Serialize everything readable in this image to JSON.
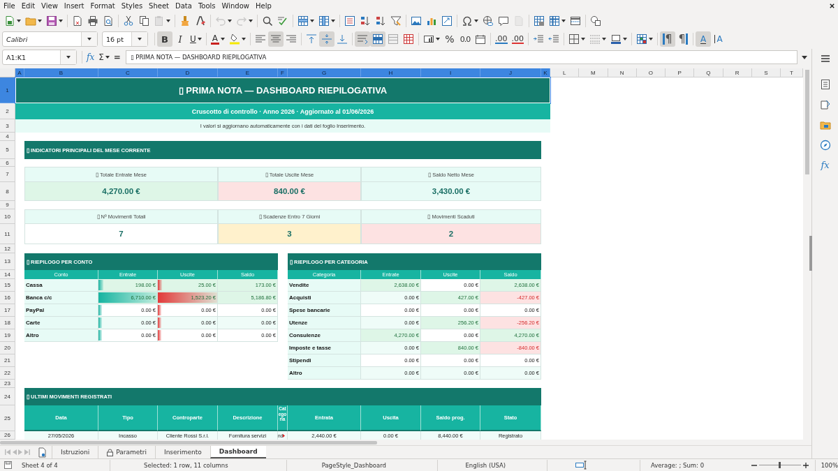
{
  "menu": [
    "File",
    "Edit",
    "View",
    "Insert",
    "Format",
    "Styles",
    "Sheet",
    "Data",
    "Tools",
    "Window",
    "Help"
  ],
  "standard_toolbar": [
    {
      "kind": "new-document",
      "dropdown": true,
      "disabled": false
    },
    {
      "kind": "open-file",
      "dropdown": true,
      "disabled": false
    },
    {
      "kind": "save",
      "dropdown": true,
      "disabled": false
    },
    {
      "kind": "separator"
    },
    {
      "kind": "export-pdf",
      "dropdown": false,
      "disabled": false
    },
    {
      "kind": "print",
      "dropdown": false,
      "disabled": false
    },
    {
      "kind": "print-preview",
      "dropdown": false,
      "disabled": false
    },
    {
      "kind": "separator"
    },
    {
      "kind": "cut",
      "dropdown": false,
      "disabled": false
    },
    {
      "kind": "copy",
      "dropdown": false,
      "disabled": false
    },
    {
      "kind": "paste",
      "dropdown": true,
      "disabled": true
    },
    {
      "kind": "separator"
    },
    {
      "kind": "clone-formatting",
      "dropdown": false,
      "disabled": false
    },
    {
      "kind": "clear-formatting",
      "dropdown": false,
      "disabled": false
    },
    {
      "kind": "separator"
    },
    {
      "kind": "undo",
      "dropdown": true,
      "disabled": true
    },
    {
      "kind": "redo",
      "dropdown": true,
      "disabled": true
    },
    {
      "kind": "separator"
    },
    {
      "kind": "find-replace",
      "dropdown": false,
      "disabled": false
    },
    {
      "kind": "spelling",
      "dropdown": false,
      "disabled": false
    },
    {
      "kind": "separator"
    },
    {
      "kind": "insert-rows",
      "dropdown": true,
      "disabled": false
    },
    {
      "kind": "insert-columns",
      "dropdown": true,
      "disabled": false
    },
    {
      "kind": "separator"
    },
    {
      "kind": "sort",
      "dropdown": false,
      "disabled": false
    },
    {
      "kind": "sort-ascending",
      "dropdown": false,
      "disabled": false
    },
    {
      "kind": "sort-descending",
      "dropdown": false,
      "disabled": false
    },
    {
      "kind": "autofilter",
      "dropdown": false,
      "disabled": false
    },
    {
      "kind": "separator"
    },
    {
      "kind": "insert-image",
      "dropdown": false,
      "disabled": false
    },
    {
      "kind": "insert-chart",
      "dropdown": false,
      "disabled": false
    },
    {
      "kind": "pivot-table",
      "dropdown": false,
      "disabled": false
    },
    {
      "kind": "separator"
    },
    {
      "kind": "special-character",
      "dropdown": true,
      "disabled": false
    },
    {
      "kind": "hyperlink",
      "dropdown": false,
      "disabled": false
    },
    {
      "kind": "comment",
      "dropdown": false,
      "disabled": false
    },
    {
      "kind": "header-footer",
      "dropdown": false,
      "disabled": true
    },
    {
      "kind": "separator"
    },
    {
      "kind": "print-range",
      "dropdown": false,
      "disabled": false
    },
    {
      "kind": "freeze-panes",
      "dropdown": true,
      "disabled": false
    },
    {
      "kind": "split-window",
      "dropdown": false,
      "disabled": false
    },
    {
      "kind": "separator"
    },
    {
      "kind": "shapes",
      "dropdown": false,
      "disabled": false
    }
  ],
  "font_name": "Calibri",
  "font_size": "16 pt",
  "format_toolbar": [
    {
      "kind": "bold",
      "label": "B",
      "dropdown": false,
      "pressed": true
    },
    {
      "kind": "italic",
      "label": "I",
      "dropdown": false,
      "pressed": false
    },
    {
      "kind": "underline",
      "label": "U",
      "dropdown": true,
      "pressed": false
    },
    {
      "kind": "separator"
    },
    {
      "kind": "font-color",
      "label": "A",
      "dropdown": true,
      "pressed": false
    },
    {
      "kind": "highlight",
      "dropdown": true,
      "pressed": false
    },
    {
      "kind": "separator"
    },
    {
      "kind": "align-left",
      "dropdown": false,
      "pressed": false
    },
    {
      "kind": "align-center",
      "dropdown": false,
      "pressed": true
    },
    {
      "kind": "align-right",
      "dropdown": false,
      "pressed": false
    },
    {
      "kind": "separator"
    },
    {
      "kind": "align-top",
      "dropdown": false,
      "pressed": false
    },
    {
      "kind": "align-middle",
      "dropdown": false,
      "pressed": true
    },
    {
      "kind": "align-bottom",
      "dropdown": false,
      "pressed": false
    },
    {
      "kind": "separator"
    },
    {
      "kind": "wrap-text",
      "dropdown": false,
      "pressed": true
    },
    {
      "kind": "merge-center",
      "dropdown": false,
      "pressed": true
    },
    {
      "kind": "merge-cells",
      "dropdown": false,
      "pressed": false
    },
    {
      "kind": "unmerge-cells",
      "dropdown": false,
      "pressed": false
    },
    {
      "kind": "separator"
    },
    {
      "kind": "number-format",
      "dropdown": true,
      "pressed": false
    },
    {
      "kind": "percent",
      "label": "%",
      "dropdown": false,
      "pressed": false
    },
    {
      "kind": "number",
      "label": "0.0",
      "dropdown": false,
      "pressed": false
    },
    {
      "kind": "date",
      "dropdown": false,
      "pressed": false
    },
    {
      "kind": "separator"
    },
    {
      "kind": "add-decimal",
      "label": ".00",
      "dropdown": false,
      "pressed": false
    },
    {
      "kind": "delete-decimal",
      "label": ".00",
      "dropdown": false,
      "pressed": false
    },
    {
      "kind": "separator"
    },
    {
      "kind": "increase-indent",
      "dropdown": false,
      "pressed": false
    },
    {
      "kind": "decrease-indent",
      "dropdown": false,
      "pressed": false
    },
    {
      "kind": "separator"
    },
    {
      "kind": "borders",
      "dropdown": true,
      "pressed": false
    },
    {
      "kind": "border-style",
      "dropdown": true,
      "pressed": false
    },
    {
      "kind": "border-color",
      "dropdown": true,
      "pressed": false
    },
    {
      "kind": "separator"
    },
    {
      "kind": "conditional-format",
      "dropdown": true,
      "pressed": false
    },
    {
      "kind": "separator"
    },
    {
      "kind": "left-to-right",
      "label": "¶",
      "dropdown": false,
      "pressed": true
    },
    {
      "kind": "right-to-left",
      "label": "¶",
      "dropdown": false,
      "pressed": false
    },
    {
      "kind": "separator"
    },
    {
      "kind": "text-left-to-right",
      "label": "A",
      "dropdown": false,
      "pressed": true
    },
    {
      "kind": "text-top-to-bottom",
      "label": "A",
      "dropdown": false,
      "pressed": false
    }
  ],
  "formula_bar": {
    "name_box": "A1:K1",
    "function_label": "fx",
    "sum_label": "Σ",
    "equals_label": "=",
    "content": "▯ PRIMA NOTA — DASHBOARD RIEPILOGATIVA"
  },
  "sidebar": {
    "functions_label": "fx"
  },
  "columns": [
    {
      "label": "A",
      "selected": true
    },
    {
      "label": "B",
      "selected": true
    },
    {
      "label": "C",
      "selected": true
    },
    {
      "label": "D",
      "selected": true
    },
    {
      "label": "E",
      "selected": true
    },
    {
      "label": "F",
      "selected": true
    },
    {
      "label": "G",
      "selected": true
    },
    {
      "label": "H",
      "selected": true
    },
    {
      "label": "I",
      "selected": true
    },
    {
      "label": "J",
      "selected": true
    },
    {
      "label": "K",
      "selected": true
    },
    {
      "label": "L",
      "selected": false
    },
    {
      "label": "M",
      "selected": false
    },
    {
      "label": "N",
      "selected": false
    },
    {
      "label": "O",
      "selected": false
    },
    {
      "label": "P",
      "selected": false
    },
    {
      "label": "Q",
      "selected": false
    },
    {
      "label": "R",
      "selected": false
    },
    {
      "label": "S",
      "selected": false
    },
    {
      "label": "T",
      "selected": false
    }
  ],
  "rows": [
    {
      "label": "1",
      "selected": true
    },
    {
      "label": "2",
      "selected": false
    },
    {
      "label": "3",
      "selected": false
    },
    {
      "label": "4",
      "selected": false
    },
    {
      "label": "5",
      "selected": false
    },
    {
      "label": "6",
      "selected": false
    },
    {
      "label": "7",
      "selected": false
    },
    {
      "label": "8",
      "selected": false
    },
    {
      "label": "9",
      "selected": false
    },
    {
      "label": "10",
      "selected": false
    },
    {
      "label": "11",
      "selected": false
    },
    {
      "label": "12",
      "selected": false
    },
    {
      "label": "13",
      "selected": false
    },
    {
      "label": "14",
      "selected": false
    },
    {
      "label": "15",
      "selected": false
    },
    {
      "label": "16",
      "selected": false
    },
    {
      "label": "17",
      "selected": false
    },
    {
      "label": "18",
      "selected": false
    },
    {
      "label": "19",
      "selected": false
    },
    {
      "label": "20",
      "selected": false
    },
    {
      "label": "21",
      "selected": false
    },
    {
      "label": "22",
      "selected": false
    },
    {
      "label": "23",
      "selected": false
    },
    {
      "label": "24",
      "selected": false
    },
    {
      "label": "25",
      "selected": false
    },
    {
      "label": "26",
      "selected": false
    }
  ],
  "title": "▯ PRIMA NOTA — DASHBOARD RIEPILOGATIVA",
  "subtitle": "Cruscotto di controllo · Anno 2026 · Aggiornato al 01/06/2026",
  "note": "I valori si aggiornano automaticamente con i dati del foglio Inserimento.",
  "kpi_section": "▯ INDICATORI PRINCIPALI DEL MESE CORRENTE",
  "kpis": [
    {
      "label": "▯ Totale Entrate Mese",
      "value": "4,270.00 €",
      "color": "#def6e7"
    },
    {
      "label": "▯ Totale Uscite Mese",
      "value": "840.00 €",
      "color": "#fde2e2"
    },
    {
      "label": "▯ Saldo Netto Mese",
      "value": "3,430.00 €",
      "color": "#e7fbf6"
    },
    {
      "label": "▯ Nº Movimenti Totali",
      "value": "7",
      "color": "#ffffff"
    },
    {
      "label": "▯ Scadenze Entro 7 Giorni",
      "value": "3",
      "color": "#fff1cc"
    },
    {
      "label": "▯ Movimenti Scaduti",
      "value": "2",
      "color": "#fde2e2"
    }
  ],
  "account_summary": {
    "title": "▯ RIEPILOGO PER CONTO",
    "columns": [
      "Conto",
      "Entrate",
      "Uscite",
      "Saldo"
    ],
    "rows": [
      {
        "name": "Cassa",
        "in": {
          "text": "198.00 €",
          "kind": "positive",
          "level": 0.03
        },
        "out": {
          "text": "25.00 €",
          "kind": "positive",
          "level": 0.016
        },
        "balance": {
          "text": "173.00 €",
          "kind": "positive"
        }
      },
      {
        "name": "Banca c/c",
        "in": {
          "text": "6,710.00 €",
          "kind": "positive",
          "level": 1
        },
        "out": {
          "text": "1,523.20 €",
          "kind": "positive",
          "level": 1
        },
        "balance": {
          "text": "5,186.80 €",
          "kind": "positive"
        }
      },
      {
        "name": "PayPal",
        "in": {
          "text": "0.00 €",
          "kind": "zero",
          "level": 0
        },
        "out": {
          "text": "0.00 €",
          "kind": "zero",
          "level": 0
        },
        "balance": {
          "text": "0.00 €",
          "kind": "zero"
        }
      },
      {
        "name": "Carte",
        "in": {
          "text": "0.00 €",
          "kind": "zero",
          "level": 0
        },
        "out": {
          "text": "0.00 €",
          "kind": "zero",
          "level": 0
        },
        "balance": {
          "text": "0.00 €",
          "kind": "zero"
        }
      },
      {
        "name": "Altro",
        "in": {
          "text": "0.00 €",
          "kind": "zero",
          "level": 0
        },
        "out": {
          "text": "0.00 €",
          "kind": "zero",
          "level": 0
        },
        "balance": {
          "text": "0.00 €",
          "kind": "zero"
        }
      }
    ]
  },
  "category_summary": {
    "title": "▯ RIEPILOGO PER CATEGORIA",
    "columns": [
      "Categoria",
      "Entrate",
      "Uscite",
      "Saldo"
    ],
    "rows": [
      {
        "name": "Vendite",
        "in": {
          "text": "2,638.00 €",
          "kind": "positive"
        },
        "out": {
          "text": "0.00 €",
          "kind": "zero"
        },
        "balance": {
          "text": "2,638.00 €",
          "kind": "positive"
        }
      },
      {
        "name": "Acquisti",
        "in": {
          "text": "0.00 €",
          "kind": "zero"
        },
        "out": {
          "text": "427.00 €",
          "kind": "positive"
        },
        "balance": {
          "text": "-427.00 €",
          "kind": "negative"
        }
      },
      {
        "name": "Spese bancarie",
        "in": {
          "text": "0.00 €",
          "kind": "zero"
        },
        "out": {
          "text": "0.00 €",
          "kind": "zero"
        },
        "balance": {
          "text": "0.00 €",
          "kind": "zero"
        }
      },
      {
        "name": "Utenze",
        "in": {
          "text": "0.00 €",
          "kind": "zero"
        },
        "out": {
          "text": "256.20 €",
          "kind": "positive"
        },
        "balance": {
          "text": "-256.20 €",
          "kind": "negative"
        }
      },
      {
        "name": "Consulenze",
        "in": {
          "text": "4,270.00 €",
          "kind": "positive"
        },
        "out": {
          "text": "0.00 €",
          "kind": "zero"
        },
        "balance": {
          "text": "4,270.00 €",
          "kind": "positive"
        }
      },
      {
        "name": "Imposte e tasse",
        "in": {
          "text": "0.00 €",
          "kind": "zero"
        },
        "out": {
          "text": "840.00 €",
          "kind": "positive"
        },
        "balance": {
          "text": "-840.00 €",
          "kind": "negative"
        }
      },
      {
        "name": "Stipendi",
        "in": {
          "text": "0.00 €",
          "kind": "zero"
        },
        "out": {
          "text": "0.00 €",
          "kind": "zero"
        },
        "balance": {
          "text": "0.00 €",
          "kind": "zero"
        }
      },
      {
        "name": "Altro",
        "in": {
          "text": "0.00 €",
          "kind": "zero"
        },
        "out": {
          "text": "0.00 €",
          "kind": "zero"
        },
        "balance": {
          "text": "0.00 €",
          "kind": "zero"
        }
      }
    ]
  },
  "recent": {
    "title": "▯ ULTIMI MOVIMENTI REGISTRATI",
    "columns": [
      "Data",
      "Tipo",
      "Controparte",
      "Descrizione",
      "Categoria",
      "Entrata",
      "Uscita",
      "Saldo prog.",
      "Stato"
    ],
    "rows": [
      {
        "cells": [
          "27/05/2026",
          "Incasso",
          "Cliente Rossi S.r.l.",
          "Fornitura servizi",
          "nd",
          "2,440.00 €",
          "0.00 €",
          "8,440.00 €",
          "Registrato"
        ],
        "clipped": true
      }
    ]
  },
  "tabs": [
    {
      "label": "Istruzioni",
      "selected": false,
      "locked": false
    },
    {
      "label": "Parametri",
      "selected": false,
      "locked": true
    },
    {
      "label": "Inserimento",
      "selected": false,
      "locked": false
    },
    {
      "label": "Dashboard",
      "selected": true,
      "locked": false
    }
  ],
  "status_bar": {
    "sheet": "Sheet 4 of 4",
    "selection": "Selected: 1 row, 11 columns",
    "page_style": "PageStyle_Dashboard",
    "language": "English (USA)",
    "summary": "Average: ; Sum: 0",
    "zoom": "100%",
    "zoom_slider": {
      "level": 0.5
    }
  }
}
